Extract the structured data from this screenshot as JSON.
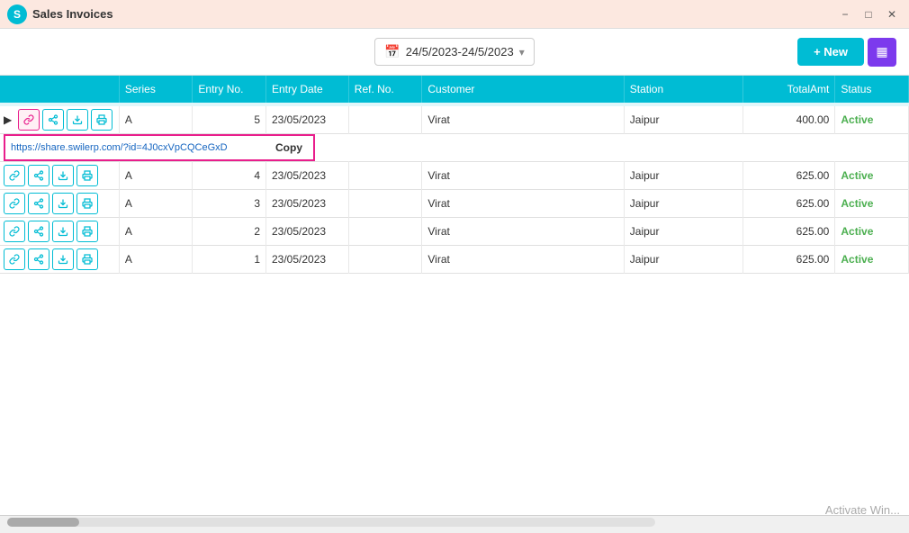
{
  "titleBar": {
    "appName": "Sales Invoices",
    "appInitial": "S",
    "minimizeLabel": "−",
    "maximizeLabel": "□",
    "closeLabel": "✕"
  },
  "toolbar": {
    "dateRange": "24/5/2023-24/5/2023",
    "newButtonLabel": "+ New",
    "filterIcon": "≡"
  },
  "table": {
    "columns": [
      "",
      "Series",
      "Entry No.",
      "Entry Date",
      "Ref. No.",
      "Customer",
      "Station",
      "TotalAmt",
      "Status"
    ],
    "urlInput": "https://share.swilerp.com/?id=4J0cxVpCQCeGxD",
    "copyLabel": "Copy",
    "rows": [
      {
        "series": "A",
        "entryNo": "5",
        "entryDate": "23/05/2023",
        "refNo": "",
        "customer": "Virat",
        "station": "Jaipur",
        "totalAmt": "400.00",
        "status": "Active",
        "highlighted": true
      },
      {
        "series": "A",
        "entryNo": "4",
        "entryDate": "23/05/2023",
        "refNo": "",
        "customer": "Virat",
        "station": "Jaipur",
        "totalAmt": "625.00",
        "status": "Active",
        "highlighted": false
      },
      {
        "series": "A",
        "entryNo": "3",
        "entryDate": "23/05/2023",
        "refNo": "",
        "customer": "Virat",
        "station": "Jaipur",
        "totalAmt": "625.00",
        "status": "Active",
        "highlighted": false
      },
      {
        "series": "A",
        "entryNo": "2",
        "entryDate": "23/05/2023",
        "refNo": "",
        "customer": "Virat",
        "station": "Jaipur",
        "totalAmt": "625.00",
        "status": "Active",
        "highlighted": false
      },
      {
        "series": "A",
        "entryNo": "1",
        "entryDate": "23/05/2023",
        "refNo": "",
        "customer": "Virat",
        "station": "Jaipur",
        "totalAmt": "625.00",
        "status": "Active",
        "highlighted": false
      }
    ]
  },
  "watermark": "Activate Win..."
}
